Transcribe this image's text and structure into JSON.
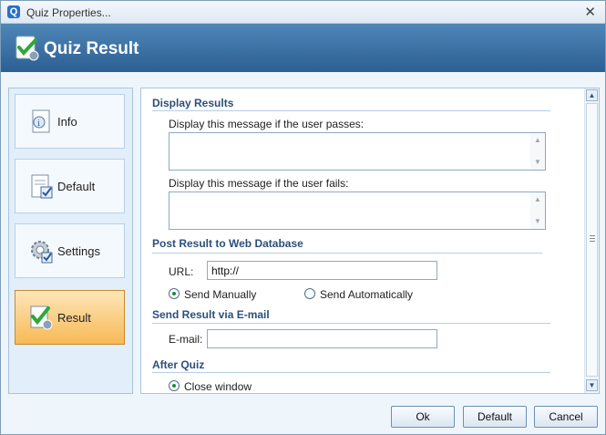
{
  "window": {
    "title": "Quiz Properties..."
  },
  "header": {
    "title": "Quiz Result"
  },
  "sidebar": {
    "items": [
      {
        "label": "Info",
        "icon": "info-document-icon"
      },
      {
        "label": "Default",
        "icon": "default-document-check-icon"
      },
      {
        "label": "Settings",
        "icon": "settings-gear-icon"
      },
      {
        "label": "Result",
        "icon": "result-check-icon",
        "active": true
      }
    ]
  },
  "display_results": {
    "heading": "Display Results",
    "pass_label": "Display this message if the user passes:",
    "pass_value": "",
    "fail_label": "Display this message if the user fails:",
    "fail_value": ""
  },
  "post_result": {
    "heading": "Post Result to Web Database",
    "url_label": "URL:",
    "url_value": "http://",
    "send_manually": "Send Manually",
    "send_automatically": "Send Automatically",
    "selected": "Send Manually"
  },
  "email_result": {
    "heading": "Send Result via E-mail",
    "email_label": "E-mail:",
    "email_value": ""
  },
  "after_quiz": {
    "heading": "After Quiz",
    "close_window": "Close window",
    "selected": "Close window"
  },
  "buttons": {
    "ok": "Ok",
    "default": "Default",
    "cancel": "Cancel"
  },
  "colors": {
    "header_bg": "#3a6fa3",
    "active_tab": "#f7b955",
    "section_text": "#2c4f7c"
  }
}
